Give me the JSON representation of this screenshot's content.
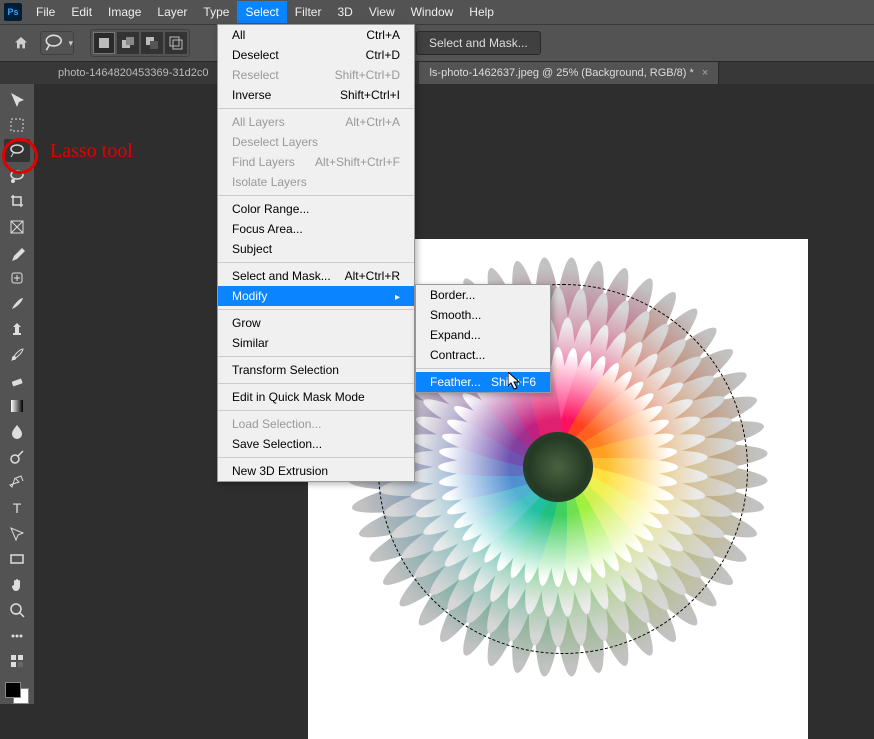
{
  "menubar": {
    "items": [
      "File",
      "Edit",
      "Image",
      "Layer",
      "Type",
      "Select",
      "Filter",
      "3D",
      "View",
      "Window",
      "Help"
    ],
    "active": "Select"
  },
  "optionsbar": {
    "select_mask_label": "Select and Mask..."
  },
  "tabs": {
    "left": "photo-1464820453369-31d2c0",
    "right": "ls-photo-1462637.jpeg @ 25% (Background, RGB/8) *"
  },
  "annotation": {
    "label": "Lasso tool"
  },
  "select_menu": [
    {
      "label": "All",
      "short": "Ctrl+A"
    },
    {
      "label": "Deselect",
      "short": "Ctrl+D"
    },
    {
      "label": "Reselect",
      "short": "Shift+Ctrl+D",
      "disabled": true
    },
    {
      "label": "Inverse",
      "short": "Shift+Ctrl+I"
    },
    {
      "sep": true
    },
    {
      "label": "All Layers",
      "short": "Alt+Ctrl+A",
      "disabled": true
    },
    {
      "label": "Deselect Layers",
      "disabled": true
    },
    {
      "label": "Find Layers",
      "short": "Alt+Shift+Ctrl+F",
      "disabled": true
    },
    {
      "label": "Isolate Layers",
      "disabled": true
    },
    {
      "sep": true
    },
    {
      "label": "Color Range..."
    },
    {
      "label": "Focus Area..."
    },
    {
      "label": "Subject"
    },
    {
      "sep": true
    },
    {
      "label": "Select and Mask...",
      "short": "Alt+Ctrl+R"
    },
    {
      "label": "Modify",
      "arrow": true,
      "hl": true
    },
    {
      "sep": true
    },
    {
      "label": "Grow"
    },
    {
      "label": "Similar"
    },
    {
      "sep": true
    },
    {
      "label": "Transform Selection"
    },
    {
      "sep": true
    },
    {
      "label": "Edit in Quick Mask Mode"
    },
    {
      "sep": true
    },
    {
      "label": "Load Selection...",
      "disabled": true
    },
    {
      "label": "Save Selection..."
    },
    {
      "sep": true
    },
    {
      "label": "New 3D Extrusion"
    }
  ],
  "modify_submenu": [
    {
      "label": "Border..."
    },
    {
      "label": "Smooth..."
    },
    {
      "label": "Expand..."
    },
    {
      "label": "Contract..."
    },
    {
      "sep": true
    },
    {
      "label": "Feather...",
      "short": "Shift+F6",
      "hl": true
    }
  ],
  "tools": [
    "move",
    "marquee",
    "lasso",
    "magic-lasso",
    "crop",
    "frame",
    "eyedropper",
    "healing",
    "brush",
    "clone",
    "history-brush",
    "eraser",
    "gradient",
    "blur",
    "dodge",
    "pen",
    "type",
    "path-select",
    "rectangle",
    "hand",
    "zoom",
    "ellipsis",
    "edit-toolbar"
  ]
}
